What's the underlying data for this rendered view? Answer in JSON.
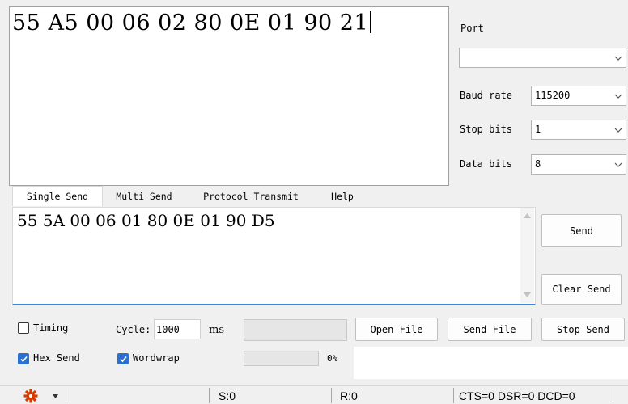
{
  "receive": {
    "text": "55 A5 00 06 02 80 0E 01 90 21"
  },
  "settings": {
    "port_label": "Port",
    "port_value": "",
    "baud_label": "Baud rate",
    "baud_value": "115200",
    "stop_label": "Stop bits",
    "stop_value": "1",
    "data_label": "Data bits",
    "data_value": "8"
  },
  "tabs": [
    {
      "label": "Single Send",
      "active": true
    },
    {
      "label": "Multi Send"
    },
    {
      "label": "Protocol Transmit"
    },
    {
      "label": "Help"
    }
  ],
  "send": {
    "text": "55 5A 00 06 01 80 0E 01 90 D5",
    "send_label": "Send",
    "clear_label": "Clear Send"
  },
  "options": {
    "timing_label": "Timing",
    "timing_checked": false,
    "cycle_label": "Cycle:",
    "cycle_value": "1000",
    "cycle_unit": "ms",
    "hex_send_label": "Hex Send",
    "hex_send_checked": true,
    "wordwrap_label": "Wordwrap",
    "wordwrap_checked": true,
    "progress_text": "0%",
    "progress_value": 0,
    "open_file_label": "Open File",
    "send_file_label": "Send File",
    "stop_send_label": "Stop Send"
  },
  "status": {
    "sent": "S:0",
    "received": "R:0",
    "signals": "CTS=0 DSR=0 DCD=0",
    "settings_icon": "gear-icon",
    "settings_color": "#d83b01"
  }
}
